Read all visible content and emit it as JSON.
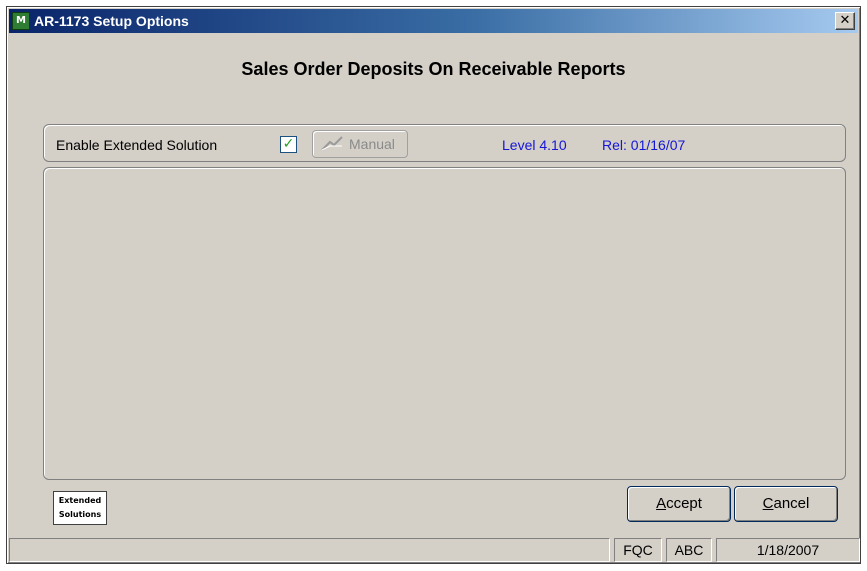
{
  "window": {
    "title": "AR-1173 Setup Options",
    "app_icon_letters": "M",
    "close_glyph": "✕"
  },
  "heading": "Sales Order Deposits On Receivable Reports",
  "options": {
    "enable_label": "Enable Extended Solution",
    "enable_checked": true,
    "check_glyph": "✓",
    "manual_label": "Manual",
    "level": "Level 4.10",
    "release": "Rel: 01/16/07"
  },
  "logo": {
    "line1": "Extended",
    "line2": "Solutions"
  },
  "buttons": {
    "accept_hotkey": "A",
    "accept_rest": "ccept",
    "cancel_hotkey": "C",
    "cancel_rest": "ancel"
  },
  "status_bar": {
    "message": "",
    "user": "FQC",
    "company": "ABC",
    "date": "1/18/2007"
  },
  "colors": {
    "accent_link": "#1515d8",
    "titlebar": "#0a246a",
    "window_bg": "#d4d0c8"
  }
}
